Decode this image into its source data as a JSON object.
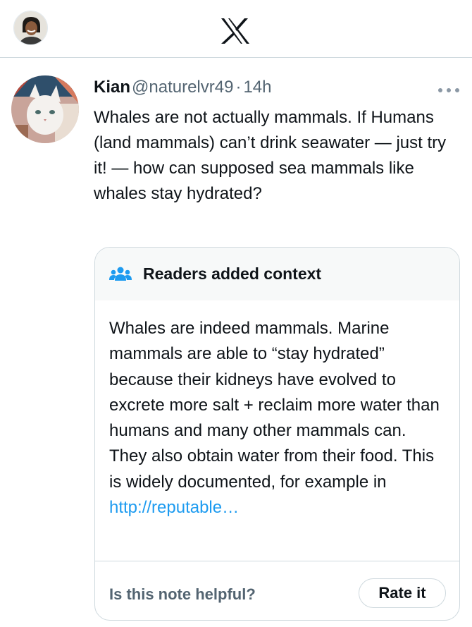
{
  "topbar": {
    "avatar_icon": "user-avatar-icon",
    "logo_icon": "x-logo-icon"
  },
  "post": {
    "avatar_icon": "cat-avatar-icon",
    "author_name": "Kian",
    "author_handle": "@naturelvr49",
    "separator": "·",
    "time": "14h",
    "more_icon": "more-dots-icon",
    "text": "Whales are not actually mammals. If Humans (land mammals) can’t drink seawater — just try it! — how can supposed sea mammals like whales stay hydrated?"
  },
  "note": {
    "icon": "people-icon",
    "title": "Readers added context",
    "body": "Whales are indeed mammals. Marine mammals are able to “stay hydrated” because their kidneys have evolved to excrete more salt + reclaim more water than humans and many other mammals can. They also obtain water from their food. This is widely documented, for example in ",
    "link_text": "http://reputable…",
    "helpful_question": "Is this note helpful?",
    "rate_label": "Rate it"
  },
  "colors": {
    "accent": "#1d9bf0",
    "text_primary": "#0f1419",
    "text_secondary": "#536471",
    "border": "#cfd9de",
    "note_header_bg": "#f7f9f9"
  }
}
